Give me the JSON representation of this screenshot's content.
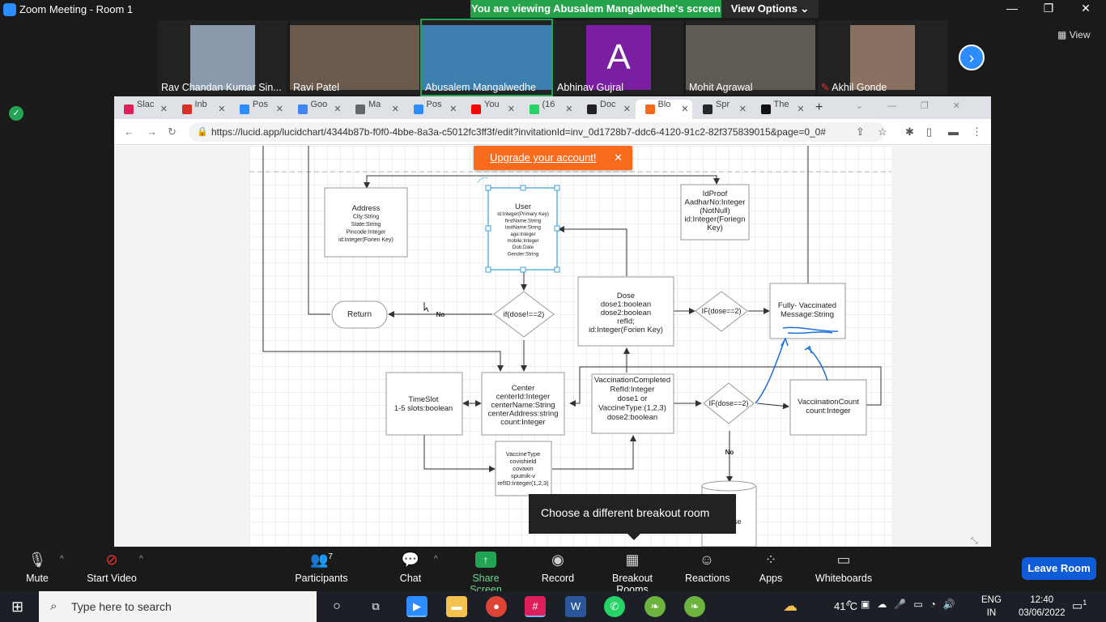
{
  "window": {
    "title": "Zoom Meeting - Room 1",
    "minimize": "—",
    "restore": "❐",
    "close": "✕"
  },
  "banner": {
    "viewing": "You are viewing Abusalem Mangalwedhe's screen",
    "view_options": "View Options ⌄"
  },
  "participants_strip": [
    {
      "name": "Rav Chandan Kumar Sin...",
      "color": "#8a9aac"
    },
    {
      "name": "Ravi Patel",
      "color": "#6a5a4e"
    },
    {
      "name": "Abusalem Mangalwedhe",
      "color": "#3d7fae",
      "active": true
    },
    {
      "name": "Abhinav Gujral",
      "color": "#7a1fa2",
      "initial": "A"
    },
    {
      "name": "Mohit Agrawal",
      "color": "#5f5a52"
    },
    {
      "name": "Akhil Gonde",
      "color": "#8a7060",
      "muted": true
    }
  ],
  "view_button": "View",
  "browser": {
    "tabs": [
      {
        "label": "Slac",
        "color": "#e01e5a"
      },
      {
        "label": "Inb",
        "color": "#d93025"
      },
      {
        "label": "Pos",
        "color": "#2d8cff"
      },
      {
        "label": "Goo",
        "color": "#4285f4"
      },
      {
        "label": "Ma",
        "color": "#666"
      },
      {
        "label": "Pos",
        "color": "#2d8cff"
      },
      {
        "label": "You",
        "color": "#ff0000"
      },
      {
        "label": "(16",
        "color": "#25d366"
      },
      {
        "label": "Doc",
        "color": "#222"
      },
      {
        "label": "Blo",
        "color": "#f96b1c",
        "active": true
      },
      {
        "label": "Spr",
        "color": "#24292e"
      },
      {
        "label": "The",
        "color": "#111"
      }
    ],
    "url": "https://lucid.app/lucidchart/4344b87b-f0f0-4bbe-8a3a-c5012fc3ff3f/edit?invitationId=inv_0d1728b7-ddc6-4120-91c2-82f375839015&page=0_0#"
  },
  "upgrade": {
    "text": "Upgrade your account!",
    "close": "✕"
  },
  "diagram": {
    "address": {
      "title": "Address",
      "fields": [
        "City:String",
        "State:String",
        "Pincode:Integer",
        "id:Integer(Forien Key)"
      ]
    },
    "user": {
      "title": "User",
      "fields": [
        "id:Integer(Primary Key)",
        "firstName:String",
        "lastName:String",
        "age:Integer",
        "mobile:Integer",
        "Dob:Date",
        "Gender:String"
      ]
    },
    "idproof": {
      "lines": [
        "IdProof",
        "AadharNo:Integer",
        "(NotNull)",
        "id:Integer(Foriegn",
        "Key)"
      ]
    },
    "dose": {
      "lines": [
        "Dose",
        "dose1:boolean",
        "dose2:boolean",
        "refId;",
        "id:Integer(Forien Key)"
      ]
    },
    "fully": {
      "lines": [
        "Fully- Vaccinated",
        "Message:String"
      ]
    },
    "return": "Return",
    "no_left": "No",
    "cond_dose_ne": "if(dose!==2)",
    "cond_dose_eq1": "IF(dose==2)",
    "cond_dose_eq2": "IF(dose==2)",
    "timeslot": {
      "lines": [
        "TimeSlot",
        "1-5 slots:boolean"
      ]
    },
    "center": {
      "lines": [
        "Center",
        "centerId:Integer",
        "centerName:String",
        "centerAddress:string",
        "count:Integer"
      ]
    },
    "vaccomp": {
      "lines": [
        "VaccinationCompleted",
        "RefId:Integer",
        "dose1 or",
        "VaccineType:(1,2,3)",
        "dose2:boolean"
      ]
    },
    "vaccount": {
      "lines": [
        "VacciinationCount",
        "count:Integer"
      ]
    },
    "vaccinetype": {
      "lines": [
        "VaccineType",
        "covishield",
        "covaxin",
        "sputnik-v",
        "refID:Integer(1,2,3)"
      ]
    },
    "no_bottom": "No",
    "db_label": "ase"
  },
  "tooltip": "Choose a different breakout room",
  "toolbar": {
    "mute": "Mute",
    "start_video": "Start Video",
    "participants": "Participants",
    "participants_count": "7",
    "chat": "Chat",
    "share_screen": "Share Screen",
    "record": "Record",
    "breakout": "Breakout Rooms",
    "reactions": "Reactions",
    "apps": "Apps",
    "whiteboards": "Whiteboards",
    "leave": "Leave Room"
  },
  "taskbar": {
    "search_placeholder": "Type here to search",
    "temperature": "41°C",
    "lang1": "ENG",
    "lang2": "IN",
    "time": "12:40",
    "date": "03/06/2022",
    "notif_count": "1"
  }
}
